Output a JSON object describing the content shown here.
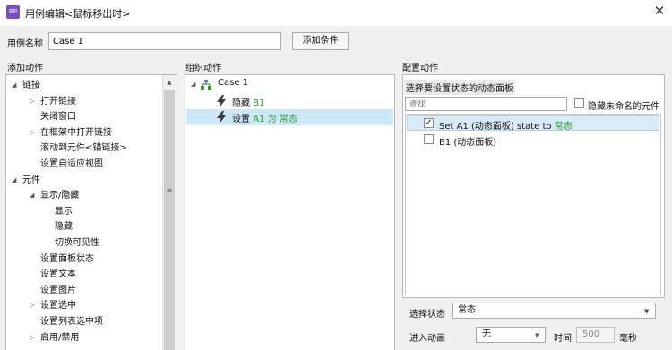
{
  "window": {
    "app_icon_text": "RP",
    "title": "用例编辑<鼠标移出时>",
    "close_glyph": "✕"
  },
  "case_name": {
    "label": "用例名称",
    "value": "Case 1",
    "add_condition_label": "添加条件"
  },
  "sections": {
    "add_actions": "添加动作",
    "organize_actions": "组织动作",
    "configure_actions": "配置动作"
  },
  "add_actions_tree": [
    {
      "label": "链接",
      "expander": "collapse",
      "level": 0
    },
    {
      "label": "打开链接",
      "expander": "expand",
      "level": 1
    },
    {
      "label": "关闭窗口",
      "expander": "none",
      "level": 1
    },
    {
      "label": "在框架中打开链接",
      "expander": "expand",
      "level": 1
    },
    {
      "label": "滚动到元件<锚链接>",
      "expander": "none",
      "level": 1
    },
    {
      "label": "设置自适应视图",
      "expander": "none",
      "level": 1
    },
    {
      "label": "元件",
      "expander": "collapse",
      "level": 0
    },
    {
      "label": "显示/隐藏",
      "expander": "collapse",
      "level": 1
    },
    {
      "label": "显示",
      "expander": "none",
      "level": 2
    },
    {
      "label": "隐藏",
      "expander": "none",
      "level": 2
    },
    {
      "label": "切换可见性",
      "expander": "none",
      "level": 2
    },
    {
      "label": "设置面板状态",
      "expander": "none",
      "level": 1
    },
    {
      "label": "设置文本",
      "expander": "none",
      "level": 1
    },
    {
      "label": "设置图片",
      "expander": "none",
      "level": 1
    },
    {
      "label": "设置选中",
      "expander": "expand",
      "level": 1
    },
    {
      "label": "设置列表选中项",
      "expander": "none",
      "level": 1
    },
    {
      "label": "启用/禁用",
      "expander": "expand",
      "level": 1
    }
  ],
  "organize": {
    "case_label": "Case 1",
    "actions": [
      {
        "verb": "隐藏",
        "target": "B1",
        "middle": "",
        "state": "",
        "selected": false
      },
      {
        "verb": "设置",
        "target": "A1",
        "middle": "为",
        "state": "常态",
        "selected": true
      }
    ]
  },
  "configure": {
    "select_panel_title": "选择要设置状态的动态面板",
    "search_placeholder": "查找",
    "hide_unnamed_label": "隐藏未命名的元件",
    "panels": [
      {
        "checked": true,
        "text": "Set A1 (动态面板) state to",
        "state": "常态",
        "selected": true
      },
      {
        "checked": false,
        "text": "B1 (动态面板)",
        "state": "",
        "selected": false
      }
    ],
    "select_state_label": "选择状态",
    "state_value": "常态",
    "enter_anim_label": "进入动画",
    "anim_value": "无",
    "time_label": "时间",
    "duration_value": "500",
    "ms_label": "毫秒"
  },
  "icons": {
    "expand": "▷",
    "collapse": "◢",
    "dropdown": "▼",
    "scroll_up": "▲",
    "grip": "≡",
    "check": "✓"
  },
  "colors": {
    "selection": "#cde8f7",
    "state_green": "#2c9a2c",
    "bolt": "#3a3a3a",
    "app_icon": "#7b4cc7"
  }
}
